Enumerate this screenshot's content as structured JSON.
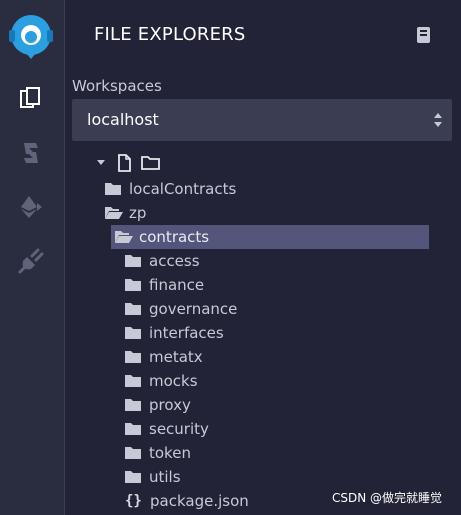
{
  "panel": {
    "title": "FILE EXPLORERS",
    "workspaces_label": "Workspaces",
    "workspace_value": "localhost"
  },
  "tree": {
    "items": [
      {
        "label": "localContracts",
        "kind": "folder-closed",
        "selected": false
      },
      {
        "label": "zp",
        "kind": "folder-open",
        "selected": false
      },
      {
        "label": "contracts",
        "kind": "folder-open",
        "selected": true
      },
      {
        "label": "access",
        "kind": "folder-closed",
        "selected": false
      },
      {
        "label": "finance",
        "kind": "folder-closed",
        "selected": false
      },
      {
        "label": "governance",
        "kind": "folder-closed",
        "selected": false
      },
      {
        "label": "interfaces",
        "kind": "folder-closed",
        "selected": false
      },
      {
        "label": "metatx",
        "kind": "folder-closed",
        "selected": false
      },
      {
        "label": "mocks",
        "kind": "folder-closed",
        "selected": false
      },
      {
        "label": "proxy",
        "kind": "folder-closed",
        "selected": false
      },
      {
        "label": "security",
        "kind": "folder-closed",
        "selected": false
      },
      {
        "label": "token",
        "kind": "folder-closed",
        "selected": false
      },
      {
        "label": "utils",
        "kind": "folder-closed",
        "selected": false
      },
      {
        "label": "package.json",
        "kind": "json-file",
        "selected": false
      }
    ]
  },
  "json_glyph": "{}",
  "watermark": "CSDN @做完就睡觉",
  "icons": [
    "remix-logo",
    "files-icon",
    "compile-icon",
    "ethereum-deploy-icon",
    "plugin-icon",
    "book-icon",
    "new-file-icon",
    "new-folder-icon",
    "caret-down-icon"
  ],
  "colors": {
    "background": "#222336",
    "sidebar": "#2a2c3f",
    "select_bg": "#3b3d52",
    "selected_row": "#53567a",
    "accent": "#2b9fe0"
  }
}
